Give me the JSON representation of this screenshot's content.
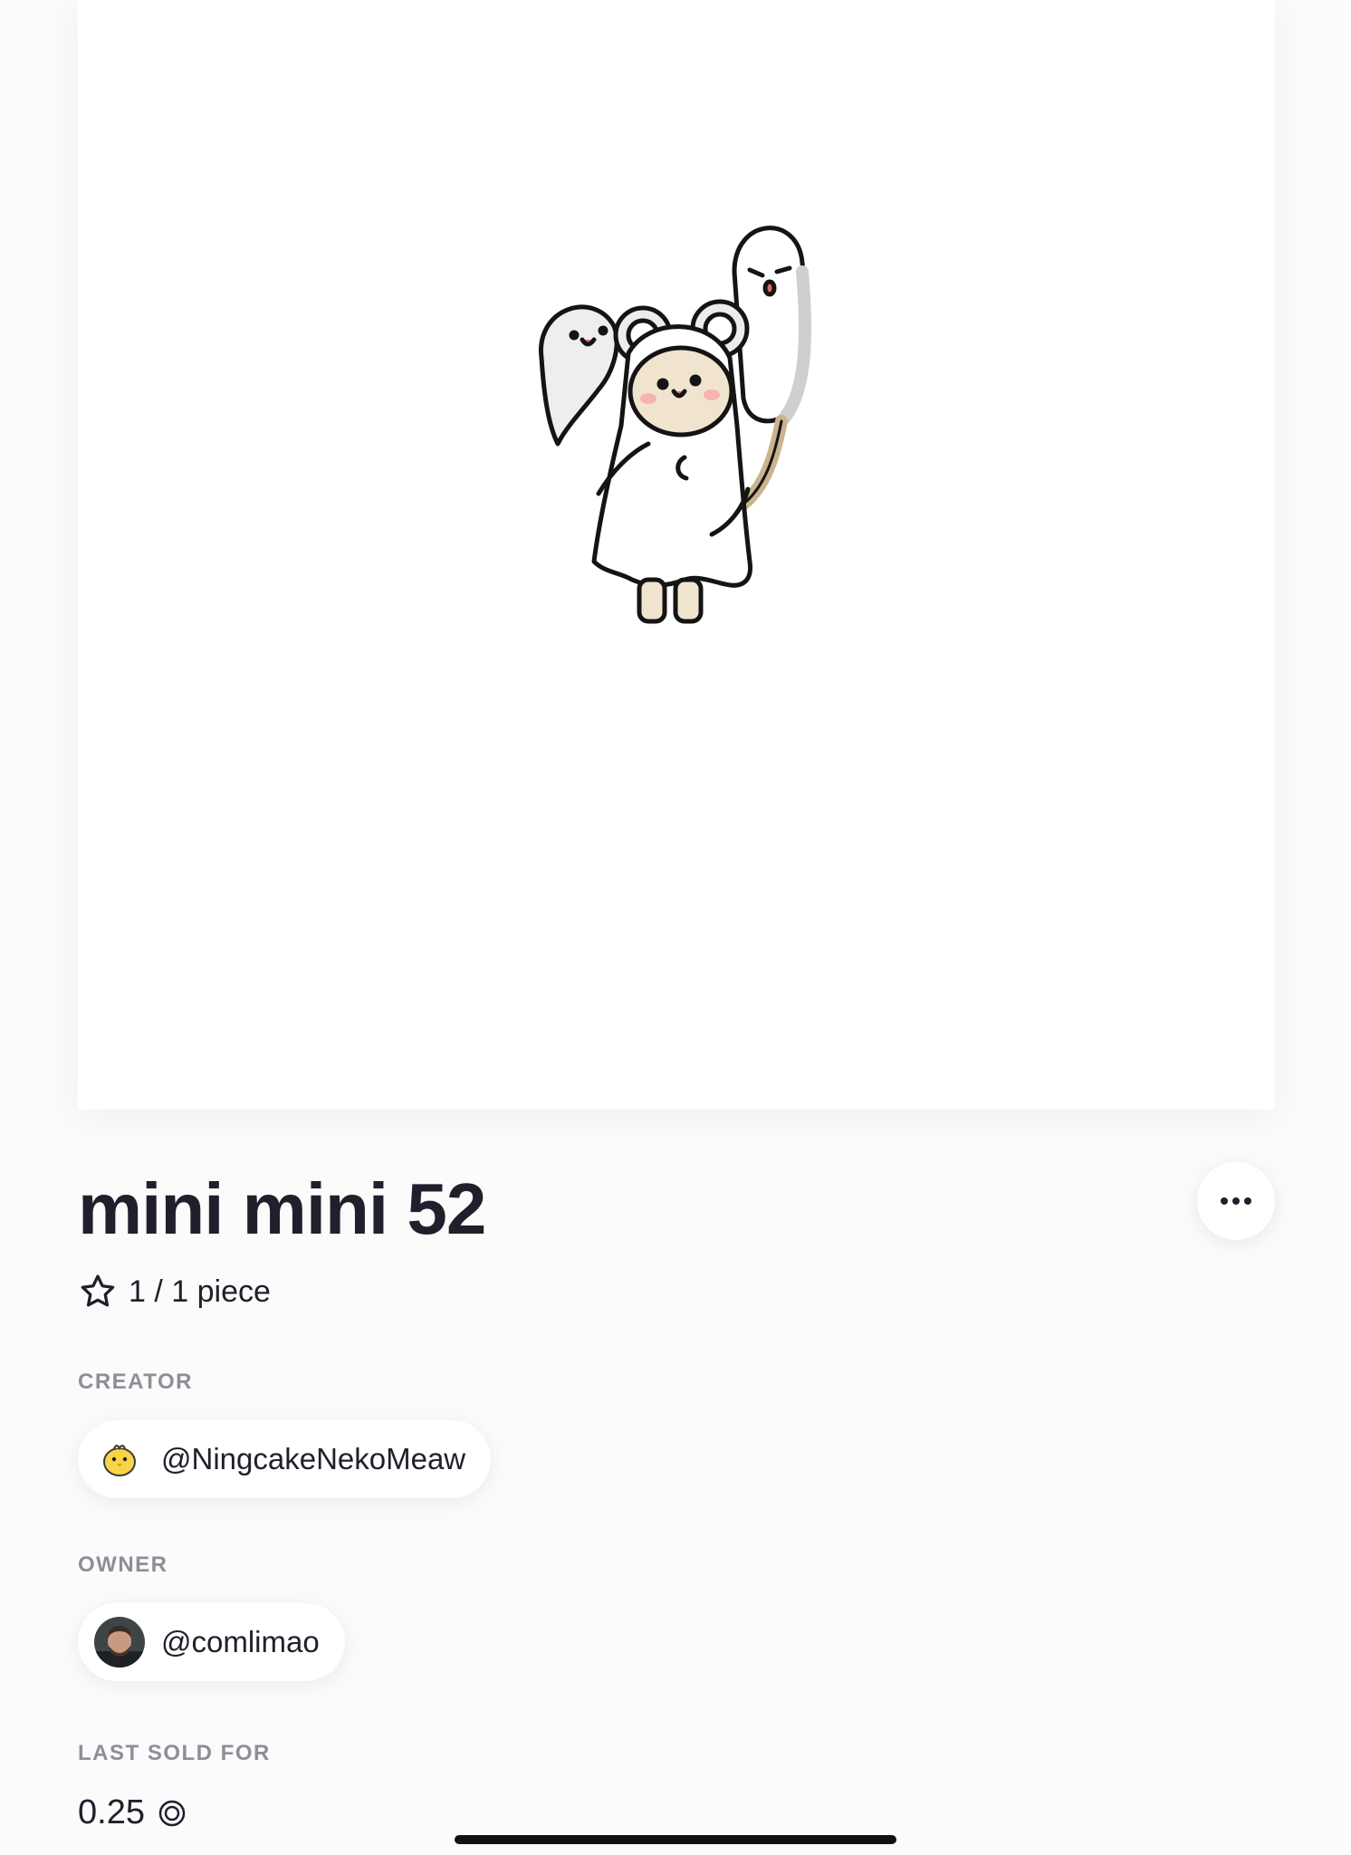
{
  "artwork": {
    "description_icon": "ghost-mouse-artwork"
  },
  "title": "mini mini 52",
  "edition": {
    "icon": "star-icon",
    "text": "1 / 1 piece"
  },
  "creator": {
    "label": "CREATOR",
    "handle": "@NingcakeNekoMeaw",
    "avatar_icon": "chick-icon"
  },
  "owner": {
    "label": "OWNER",
    "handle": "@comlimao",
    "avatar_icon": "user-avatar"
  },
  "last_sold": {
    "label": "LAST SOLD FOR",
    "value": "0.25",
    "currency_icon": "tez-icon"
  },
  "colors": {
    "text": "#20202c",
    "muted": "#8e8e98",
    "background": "#fbfbfc",
    "card": "#ffffff"
  }
}
